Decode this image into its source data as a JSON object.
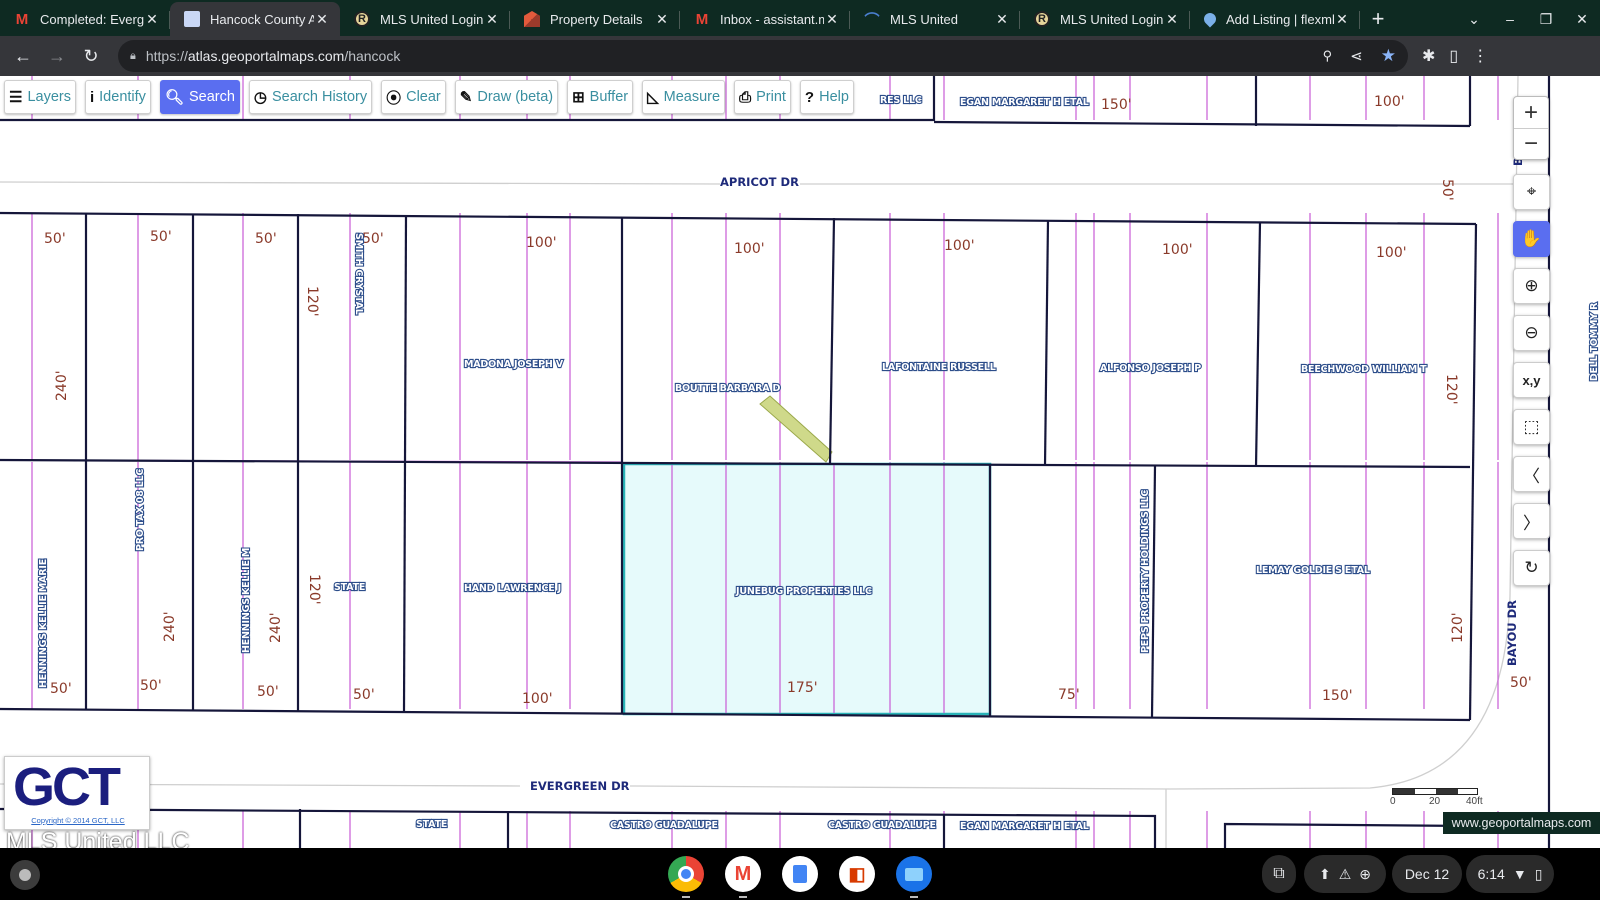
{
  "browser": {
    "tabs": [
      {
        "title": "Completed: Evergreen",
        "icon": "gmail-icon",
        "favclass": "gmail",
        "glyph": "M",
        "active": false
      },
      {
        "title": "Hancock County Atlas",
        "icon": "document-icon",
        "favclass": "doc",
        "glyph": "",
        "active": true
      },
      {
        "title": "MLS United Login",
        "icon": "mls-r-icon",
        "favclass": "mls",
        "glyph": "R",
        "active": false
      },
      {
        "title": "Property Details",
        "icon": "property-icon",
        "favclass": "prop",
        "glyph": "",
        "active": false
      },
      {
        "title": "Inbox - assistant.m",
        "icon": "gmail-icon",
        "favclass": "gmail",
        "glyph": "M",
        "active": false
      },
      {
        "title": "MLS United",
        "icon": "mls-united-icon",
        "favclass": "mlsu",
        "glyph": "⌒",
        "active": false
      },
      {
        "title": "MLS United Login",
        "icon": "mls-r-icon",
        "favclass": "mls",
        "glyph": "R",
        "active": false
      },
      {
        "title": "Add Listing | flexmls",
        "icon": "flexmls-icon",
        "favclass": "flex",
        "glyph": "",
        "active": false
      }
    ],
    "tab_close_glyph": "✕",
    "new_tab_glyph": "+",
    "window_controls": {
      "tab_search": "⌄",
      "minimize": "–",
      "restore": "❐",
      "close": "✕"
    },
    "url": {
      "scheme": "https://",
      "host": "atlas.geoportalmaps.com",
      "path": "/hancock"
    },
    "nav": {
      "back": "←",
      "forward": "→",
      "reload": "↻"
    }
  },
  "toolbar": [
    {
      "name": "layers",
      "label": "Layers",
      "icon": "☰",
      "active": false
    },
    {
      "name": "identify",
      "label": "Identify",
      "icon": "i",
      "active": false
    },
    {
      "name": "search",
      "label": "Search",
      "icon": "🔍︎",
      "active": true
    },
    {
      "name": "search-history",
      "label": "Search History",
      "icon": "◷",
      "active": false
    },
    {
      "name": "clear",
      "label": "Clear",
      "icon": "⦿",
      "active": false
    },
    {
      "name": "draw",
      "label": "Draw (beta)",
      "icon": "✎",
      "active": false
    },
    {
      "name": "buffer",
      "label": "Buffer",
      "icon": "⊞",
      "active": false
    },
    {
      "name": "measure",
      "label": "Measure",
      "icon": "◺",
      "active": false
    },
    {
      "name": "print",
      "label": "Print",
      "icon": "⎙",
      "active": false
    },
    {
      "name": "help",
      "label": "Help",
      "icon": "?",
      "active": false
    }
  ],
  "map_controls": {
    "zoom_in": "+",
    "zoom_out": "−",
    "buttons": [
      {
        "name": "locate",
        "glyph": "⌖",
        "active": false
      },
      {
        "name": "pan",
        "glyph": "✋",
        "active": true
      },
      {
        "name": "zoom-in-box",
        "glyph": "⊕",
        "active": false
      },
      {
        "name": "zoom-out-box",
        "glyph": "⊖",
        "active": false
      },
      {
        "name": "xy",
        "glyph": "x,y",
        "active": false
      },
      {
        "name": "full-extent",
        "glyph": "⬚",
        "active": false
      },
      {
        "name": "previous-extent",
        "glyph": "〈",
        "active": false
      },
      {
        "name": "next-extent",
        "glyph": "〉",
        "active": false
      },
      {
        "name": "refresh",
        "glyph": "↻",
        "active": false
      }
    ]
  },
  "map": {
    "streets": [
      "APRICOT DR",
      "EVERGREEN DR",
      "BAYOU DR",
      "BAYOU DR"
    ],
    "owners_top_row": [
      "SMITH CRYSTAL",
      "MADONA JOSEPH V",
      "BOUTTE BARBARA D",
      "LAFONTAINE RUSSELL",
      "ALFONSO JOSEPH P",
      "BEECHWOOD WILLIAM T",
      "DELL TOMMY R"
    ],
    "owners_bottom_row": [
      "HENNINGS KELLIE MARIE",
      "PRO TAX 08 LLC",
      "HENNINGS KELLIE M",
      "STATE",
      "HAND LAWRENCE J",
      "JUNEBUG PROPERTIES LLC",
      "PEPS PROPERTY HOLDINGS LLC",
      "LEMAY GOLDIE S ETAL"
    ],
    "owners_north": [
      "RES LLC",
      "EGAN MARGARET H ETAL"
    ],
    "owners_south": [
      "STATE",
      "CASTRO GUADALUPE",
      "CASTRO GUADALUPE",
      "EGAN MARGARET H ETAL"
    ],
    "dims_top_row": [
      "50'",
      "50'",
      "50'",
      "50'",
      "100'",
      "100'",
      "100'",
      "100'",
      "100'"
    ],
    "dims_top_side": [
      "240'",
      "120'",
      "120'",
      "50'"
    ],
    "dims_bottom_row": [
      "50'",
      "50'",
      "50'",
      "50'",
      "100'",
      "175'",
      "75'",
      "150'"
    ],
    "dims_bottom_side": [
      "240'",
      "240'",
      "120'",
      "120'",
      "50'"
    ],
    "dims_north": [
      "150'",
      "100'"
    ],
    "selected_parcel": "JUNEBUG PROPERTIES LLC",
    "selected_color": "#2ab3b8"
  },
  "scalebar": {
    "labels": [
      "0",
      "20",
      "40ft"
    ]
  },
  "branding": {
    "logo": "GCT",
    "copyright": "Copyright © 2014 GCT, LLC",
    "watermark": "www.geoportalmaps.com",
    "overlay": "MLS United LLC"
  },
  "shelf": {
    "apps": [
      "Chrome",
      "Gmail",
      "Docs",
      "Office",
      "Files"
    ],
    "date": "Dec 12",
    "time": "6:14"
  }
}
